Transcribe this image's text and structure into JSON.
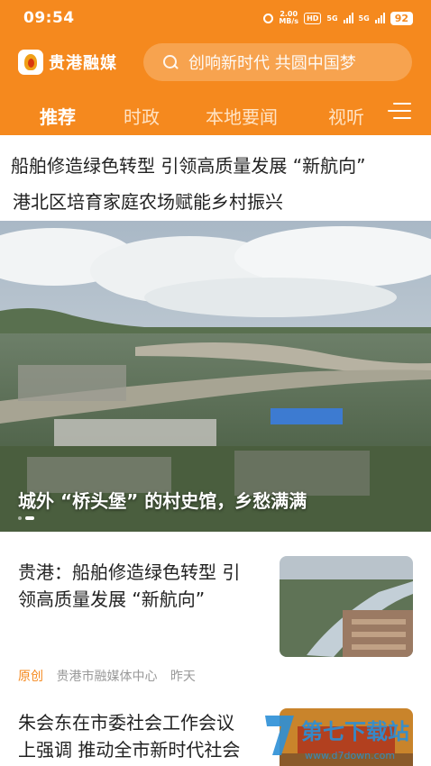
{
  "status_bar": {
    "time": "09:54",
    "net_speed_value": "2.00",
    "net_speed_unit": "MB/s",
    "hd_label": "HD",
    "network_1": "5G",
    "network_2": "5G",
    "battery": "92"
  },
  "header": {
    "app_name": "贵港融媒",
    "search_placeholder": "创响新时代 共圆中国梦",
    "brand_color": "#F5891E"
  },
  "tabs": [
    {
      "label": "推荐",
      "active": true
    },
    {
      "label": "时政",
      "active": false
    },
    {
      "label": "本地要闻",
      "active": false
    },
    {
      "label": "视听",
      "active": false
    }
  ],
  "headlines": [
    "船舶修造绿色转型 引领高质量发展 “新航向”",
    "港北区培育家庭农场赋能乡村振兴"
  ],
  "banner": {
    "caption": "城外 “桥头堡” 的村史馆，乡愁满满",
    "slide_count": 2,
    "current_slide": 2
  },
  "news": [
    {
      "title_line1": "贵港：船舶修造绿色转型 引",
      "title_line2": "领高质量发展 “新航向”",
      "tag": "原创",
      "source": "贵港市融媒体中心",
      "time": "昨天"
    },
    {
      "title_line1": "朱会东在市委社会工作会议",
      "title_line2": "上强调 推动全市新时代社会"
    }
  ],
  "watermark": {
    "text": "第七下载站",
    "url": "www.d7down.com"
  }
}
